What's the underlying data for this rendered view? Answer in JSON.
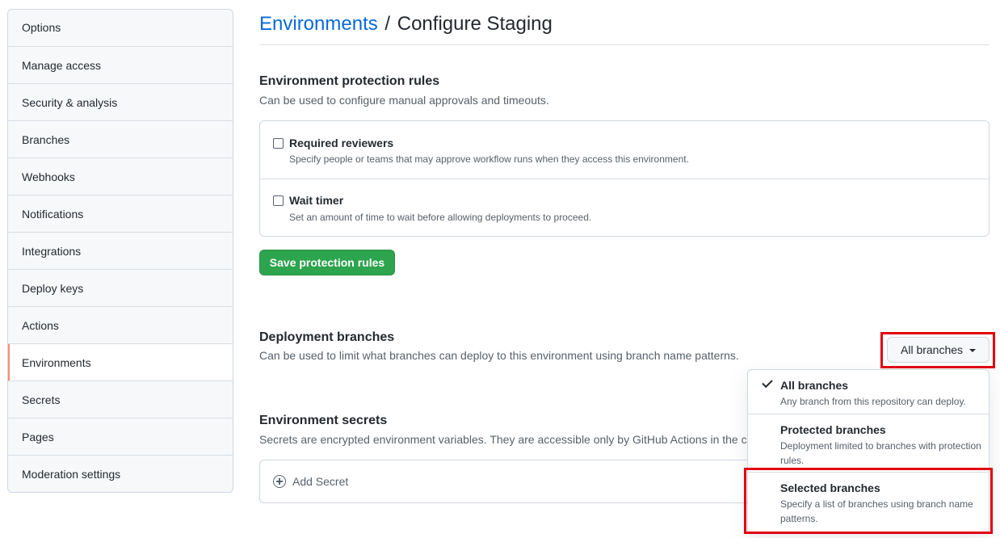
{
  "sidebar": {
    "items": [
      {
        "label": "Options"
      },
      {
        "label": "Manage access"
      },
      {
        "label": "Security & analysis"
      },
      {
        "label": "Branches"
      },
      {
        "label": "Webhooks"
      },
      {
        "label": "Notifications"
      },
      {
        "label": "Integrations"
      },
      {
        "label": "Deploy keys"
      },
      {
        "label": "Actions"
      },
      {
        "label": "Environments",
        "active": true
      },
      {
        "label": "Secrets"
      },
      {
        "label": "Pages"
      },
      {
        "label": "Moderation settings"
      }
    ]
  },
  "header": {
    "breadcrumb_link": "Environments",
    "separator": "/",
    "title": "Configure Staging"
  },
  "protection": {
    "title": "Environment protection rules",
    "description": "Can be used to configure manual approvals and timeouts.",
    "rules": [
      {
        "label": "Required reviewers",
        "description": "Specify people or teams that may approve workflow runs when they access this environment.",
        "checked": false
      },
      {
        "label": "Wait timer",
        "description": "Set an amount of time to wait before allowing deployments to proceed.",
        "checked": false
      }
    ],
    "save_label": "Save protection rules"
  },
  "deployment": {
    "title": "Deployment branches",
    "description": "Can be used to limit what branches can deploy to this environment using branch name patterns.",
    "selected": "All branches",
    "options": [
      {
        "label": "All branches",
        "description": "Any branch from this repository can deploy.",
        "checked": true
      },
      {
        "label": "Protected branches",
        "description": "Deployment limited to branches with protection rules."
      },
      {
        "label": "Selected branches",
        "description": "Specify a list of branches using branch name patterns."
      }
    ]
  },
  "secrets": {
    "title": "Environment secrets",
    "description": "Secrets are encrypted environment variables. They are accessible only by GitHub Actions in the con",
    "add_label": "Add Secret"
  },
  "colors": {
    "link": "#0969da",
    "primary_button": "#2da44e",
    "highlight": "#e3000f",
    "active_indicator": "#fd8c73"
  }
}
